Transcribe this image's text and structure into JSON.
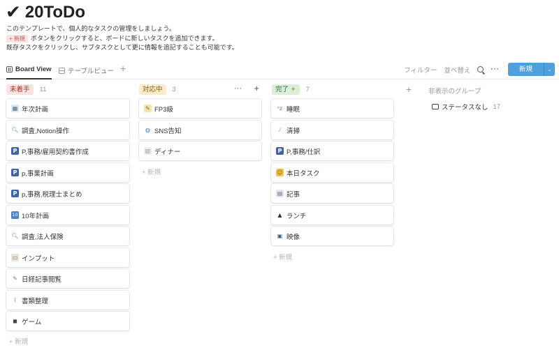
{
  "page": {
    "title": "20ToDo",
    "description": [
      "このテンプレートで、個人的なタスクの管理をしましょう。",
      "ボタンをクリックすると、ボードに新しいタスクを追加できます。",
      "既存タスクをクリックし、サブタスクとして更に情報を追記することも可能です。"
    ],
    "inline_tag": "+ 新規"
  },
  "views": {
    "active": "Board View",
    "other": "テーブルビュー",
    "add": "+"
  },
  "toolbar": {
    "filter": "フィルター",
    "sort": "並べ替え",
    "more": "···",
    "new": "新規",
    "caret": "⌄"
  },
  "columns": [
    {
      "name": "未着手",
      "count": "11",
      "color_bg": "#fde2e0",
      "color_fg": "#9f3a2e",
      "cards": [
        {
          "label": "年次計画",
          "icon": "calendar-icon",
          "glyph": "▦",
          "bg": "#dfe8f0",
          "fg": "#4f6d86"
        },
        {
          "label": "調査,Notion操作",
          "icon": "magnifier-icon",
          "glyph": "🔍︎",
          "bg": "transparent",
          "fg": "#5b7fa0"
        },
        {
          "label": "P,事務/雇用契約書作成",
          "icon": "parking-icon",
          "glyph": "P",
          "bg": "#3d63a8",
          "fg": "#ffffff"
        },
        {
          "label": "p,事業計画",
          "icon": "parking-icon",
          "glyph": "P",
          "bg": "#3d63a8",
          "fg": "#ffffff"
        },
        {
          "label": "p,事務,税理士まとめ",
          "icon": "parking-icon",
          "glyph": "P",
          "bg": "#3d63a8",
          "fg": "#ffffff"
        },
        {
          "label": "10年計画",
          "icon": "keycap-ten-icon",
          "glyph": "10",
          "bg": "#4a86c8",
          "fg": "#ffffff"
        },
        {
          "label": "調査,法人保険",
          "icon": "magnifier-icon",
          "glyph": "🔍︎",
          "bg": "transparent",
          "fg": "#5b7fa0"
        },
        {
          "label": "インプット",
          "icon": "open-book-icon",
          "glyph": "▭",
          "bg": "#e8e4d8",
          "fg": "#7a6e55"
        },
        {
          "label": "日経記事閲覧",
          "icon": "pen-icon",
          "glyph": "✎",
          "bg": "transparent",
          "fg": "#7a7a7a"
        },
        {
          "label": "書類整理",
          "icon": "paperclip-icon",
          "glyph": "⌇",
          "bg": "transparent",
          "fg": "#888888"
        },
        {
          "label": "ゲーム",
          "icon": "gamepad-icon",
          "glyph": "◼",
          "bg": "transparent",
          "fg": "#444444"
        }
      ],
      "add_label": "+ 新規"
    },
    {
      "name": "対応中",
      "count": "3",
      "color_bg": "#fdecc8",
      "color_fg": "#8a5a10",
      "cards": [
        {
          "label": "FP3級",
          "icon": "memo-icon",
          "glyph": "✎",
          "bg": "#f3e3b0",
          "fg": "#8a6a20"
        },
        {
          "label": "SNS告知",
          "icon": "globe-icon",
          "glyph": "◍",
          "bg": "transparent",
          "fg": "#3a7ab8"
        },
        {
          "label": "ディナー",
          "icon": "dinner-icon",
          "glyph": "▥",
          "bg": "#eeeeee",
          "fg": "#999999"
        }
      ],
      "add_label": "+ 新規",
      "more": "···",
      "add": "+"
    },
    {
      "name": "完了",
      "count": "7",
      "color_bg": "#dbeddb",
      "color_fg": "#2b6b3f",
      "cards": [
        {
          "label": "睡眠",
          "icon": "sleep-icon",
          "glyph": "ᶻz",
          "bg": "transparent",
          "fg": "#5a6fb0"
        },
        {
          "label": "清掃",
          "icon": "broom-icon",
          "glyph": "⁄",
          "bg": "transparent",
          "fg": "#c08a3a"
        },
        {
          "label": "P,事務/仕訳",
          "icon": "parking-icon",
          "glyph": "P",
          "bg": "#3d63a8",
          "fg": "#ffffff"
        },
        {
          "label": "本日タスク",
          "icon": "smiley-icon",
          "glyph": "☺",
          "bg": "#f6c544",
          "fg": "#7a5a10"
        },
        {
          "label": "記事",
          "icon": "newspaper-icon",
          "glyph": "▤",
          "bg": "#e2e6ec",
          "fg": "#6a7a90"
        },
        {
          "label": "ランチ",
          "icon": "rice-ball-icon",
          "glyph": "▲",
          "bg": "transparent",
          "fg": "#333333"
        },
        {
          "label": "映像",
          "icon": "tv-icon",
          "glyph": "▣",
          "bg": "transparent",
          "fg": "#3d5a80"
        }
      ],
      "add_label": "+ 新規"
    }
  ],
  "hidden_groups": {
    "title": "非表示のグループ",
    "item_label": "ステータスなし",
    "item_count": "17",
    "add_group": "+"
  }
}
